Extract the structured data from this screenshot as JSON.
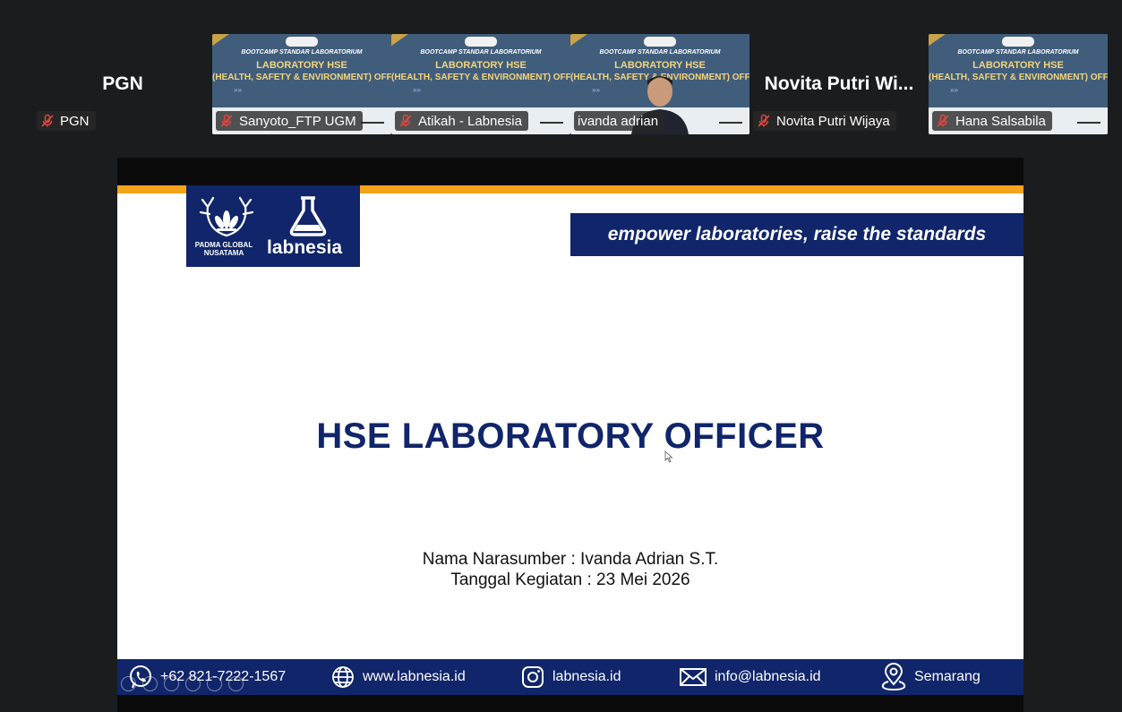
{
  "participants": [
    {
      "display_name": "PGN",
      "tag_name": "PGN",
      "mic": "mic-muted-icon",
      "view": "name"
    },
    {
      "tag_name": "Sanyoto_FTP UGM",
      "mic": "mic-muted-icon",
      "view": "slide"
    },
    {
      "tag_name": "Atikah - Labnesia",
      "mic": "mic-muted-icon",
      "view": "slide"
    },
    {
      "tag_name": "ivanda adrian",
      "view": "camera",
      "active_speaker": true
    },
    {
      "display_name": "Novita Putri Wi...",
      "tag_name": "Novita Putri Wijaya",
      "mic": "mic-muted-icon",
      "view": "name"
    },
    {
      "tag_name": "Hana Salsabila",
      "mic": "mic-muted-icon",
      "view": "slide"
    }
  ],
  "thumb_slide": {
    "line1": "BOOTCAMP STANDAR LABORATORIUM",
    "line2": "LABORATORY HSE",
    "line3": "(HEALTH, SAFETY & ENVIRONMENT) OFFICER",
    "arrows": "»»"
  },
  "slide": {
    "logo_left": "PADMA GLOBAL NUSATAMA",
    "logo_right": "labnesia",
    "tagline": "empower laboratories, raise the standards",
    "title": "HSE LABORATORY OFFICER",
    "speaker_line": "Nama Narasumber : Ivanda Adrian S.T.",
    "date_line": "Tanggal Kegiatan : 23 Mei 2026",
    "footer": {
      "phone": "+62 821-7222-1567",
      "website": "www.labnesia.id",
      "instagram": "labnesia.id",
      "email": "info@labnesia.id",
      "location": "Semarang"
    }
  },
  "colors": {
    "navy": "#10256a",
    "orange": "#f4a51c",
    "active_border": "#3fd17a",
    "muted_mic": "#e0473f"
  }
}
